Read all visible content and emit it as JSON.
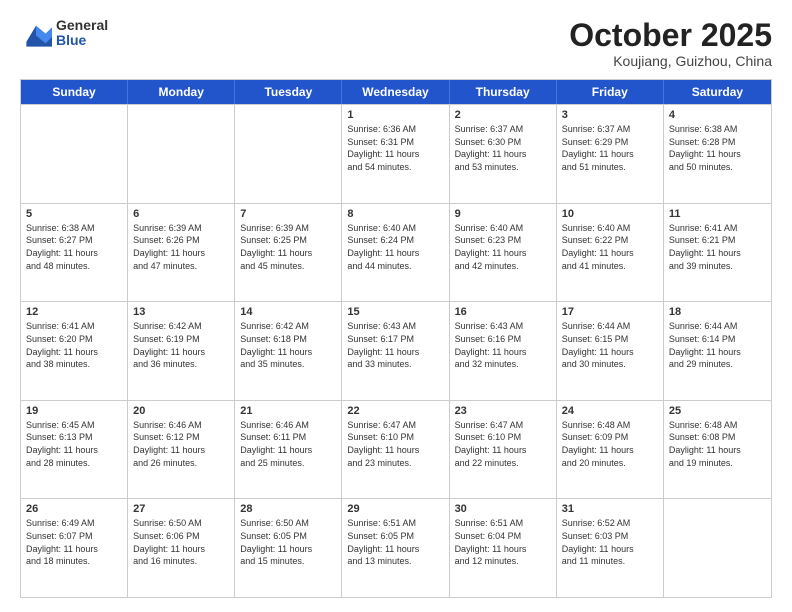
{
  "logo": {
    "general": "General",
    "blue": "Blue"
  },
  "title": "October 2025",
  "location": "Koujiang, Guizhou, China",
  "headers": [
    "Sunday",
    "Monday",
    "Tuesday",
    "Wednesday",
    "Thursday",
    "Friday",
    "Saturday"
  ],
  "weeks": [
    [
      {
        "day": "",
        "info": ""
      },
      {
        "day": "",
        "info": ""
      },
      {
        "day": "",
        "info": ""
      },
      {
        "day": "1",
        "info": "Sunrise: 6:36 AM\nSunset: 6:31 PM\nDaylight: 11 hours\nand 54 minutes."
      },
      {
        "day": "2",
        "info": "Sunrise: 6:37 AM\nSunset: 6:30 PM\nDaylight: 11 hours\nand 53 minutes."
      },
      {
        "day": "3",
        "info": "Sunrise: 6:37 AM\nSunset: 6:29 PM\nDaylight: 11 hours\nand 51 minutes."
      },
      {
        "day": "4",
        "info": "Sunrise: 6:38 AM\nSunset: 6:28 PM\nDaylight: 11 hours\nand 50 minutes."
      }
    ],
    [
      {
        "day": "5",
        "info": "Sunrise: 6:38 AM\nSunset: 6:27 PM\nDaylight: 11 hours\nand 48 minutes."
      },
      {
        "day": "6",
        "info": "Sunrise: 6:39 AM\nSunset: 6:26 PM\nDaylight: 11 hours\nand 47 minutes."
      },
      {
        "day": "7",
        "info": "Sunrise: 6:39 AM\nSunset: 6:25 PM\nDaylight: 11 hours\nand 45 minutes."
      },
      {
        "day": "8",
        "info": "Sunrise: 6:40 AM\nSunset: 6:24 PM\nDaylight: 11 hours\nand 44 minutes."
      },
      {
        "day": "9",
        "info": "Sunrise: 6:40 AM\nSunset: 6:23 PM\nDaylight: 11 hours\nand 42 minutes."
      },
      {
        "day": "10",
        "info": "Sunrise: 6:40 AM\nSunset: 6:22 PM\nDaylight: 11 hours\nand 41 minutes."
      },
      {
        "day": "11",
        "info": "Sunrise: 6:41 AM\nSunset: 6:21 PM\nDaylight: 11 hours\nand 39 minutes."
      }
    ],
    [
      {
        "day": "12",
        "info": "Sunrise: 6:41 AM\nSunset: 6:20 PM\nDaylight: 11 hours\nand 38 minutes."
      },
      {
        "day": "13",
        "info": "Sunrise: 6:42 AM\nSunset: 6:19 PM\nDaylight: 11 hours\nand 36 minutes."
      },
      {
        "day": "14",
        "info": "Sunrise: 6:42 AM\nSunset: 6:18 PM\nDaylight: 11 hours\nand 35 minutes."
      },
      {
        "day": "15",
        "info": "Sunrise: 6:43 AM\nSunset: 6:17 PM\nDaylight: 11 hours\nand 33 minutes."
      },
      {
        "day": "16",
        "info": "Sunrise: 6:43 AM\nSunset: 6:16 PM\nDaylight: 11 hours\nand 32 minutes."
      },
      {
        "day": "17",
        "info": "Sunrise: 6:44 AM\nSunset: 6:15 PM\nDaylight: 11 hours\nand 30 minutes."
      },
      {
        "day": "18",
        "info": "Sunrise: 6:44 AM\nSunset: 6:14 PM\nDaylight: 11 hours\nand 29 minutes."
      }
    ],
    [
      {
        "day": "19",
        "info": "Sunrise: 6:45 AM\nSunset: 6:13 PM\nDaylight: 11 hours\nand 28 minutes."
      },
      {
        "day": "20",
        "info": "Sunrise: 6:46 AM\nSunset: 6:12 PM\nDaylight: 11 hours\nand 26 minutes."
      },
      {
        "day": "21",
        "info": "Sunrise: 6:46 AM\nSunset: 6:11 PM\nDaylight: 11 hours\nand 25 minutes."
      },
      {
        "day": "22",
        "info": "Sunrise: 6:47 AM\nSunset: 6:10 PM\nDaylight: 11 hours\nand 23 minutes."
      },
      {
        "day": "23",
        "info": "Sunrise: 6:47 AM\nSunset: 6:10 PM\nDaylight: 11 hours\nand 22 minutes."
      },
      {
        "day": "24",
        "info": "Sunrise: 6:48 AM\nSunset: 6:09 PM\nDaylight: 11 hours\nand 20 minutes."
      },
      {
        "day": "25",
        "info": "Sunrise: 6:48 AM\nSunset: 6:08 PM\nDaylight: 11 hours\nand 19 minutes."
      }
    ],
    [
      {
        "day": "26",
        "info": "Sunrise: 6:49 AM\nSunset: 6:07 PM\nDaylight: 11 hours\nand 18 minutes."
      },
      {
        "day": "27",
        "info": "Sunrise: 6:50 AM\nSunset: 6:06 PM\nDaylight: 11 hours\nand 16 minutes."
      },
      {
        "day": "28",
        "info": "Sunrise: 6:50 AM\nSunset: 6:05 PM\nDaylight: 11 hours\nand 15 minutes."
      },
      {
        "day": "29",
        "info": "Sunrise: 6:51 AM\nSunset: 6:05 PM\nDaylight: 11 hours\nand 13 minutes."
      },
      {
        "day": "30",
        "info": "Sunrise: 6:51 AM\nSunset: 6:04 PM\nDaylight: 11 hours\nand 12 minutes."
      },
      {
        "day": "31",
        "info": "Sunrise: 6:52 AM\nSunset: 6:03 PM\nDaylight: 11 hours\nand 11 minutes."
      },
      {
        "day": "",
        "info": ""
      }
    ]
  ]
}
